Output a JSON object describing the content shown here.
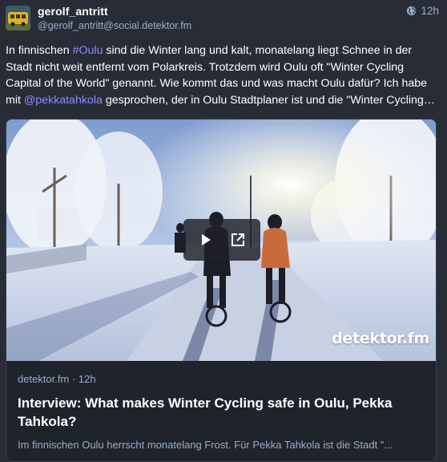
{
  "account": {
    "display_name": "gerolf_antritt",
    "handle": "@gerolf_antritt@social.detektor.fm",
    "avatar": "avatar-yellow-bus"
  },
  "post": {
    "visibility_icon": "globe-icon",
    "time": "12h",
    "lines": [
      {
        "before": "In finnischen ",
        "link": "#Oulu",
        "after": " sind die Winter lang und kalt, monatelang liegt Schnee in der"
      },
      {
        "before": "Stadt nicht weit entfernt vom Polarkreis. Trotzdem wird Oulu oft \"Winter Cycling",
        "link": "",
        "after": ""
      },
      {
        "before": "Capital of the World\" genannt. Wie kommt das und was macht Oulu dafür? Ich habe",
        "link": "",
        "after": ""
      },
      {
        "before": "mit ",
        "link": "@pekkatahkola",
        "after": " gesprochen, der in Oulu Stadtplaner ist und die \"Winter Cycling…"
      }
    ]
  },
  "card": {
    "image_icon": "winter-cyclists-photo",
    "wordmark": "detektor.fm",
    "source": "detektor.fm",
    "separator": " · ",
    "time": "12h",
    "title": "Interview: What makes Winter Cycling safe in Oulu, Pekka Tahkola?",
    "description": "Im finnischen Oulu herrscht monatelang Frost. Für Pekka Tahkola ist die Stadt \"..."
  },
  "colors": {
    "background": "#282c37",
    "link": "#8c8dff",
    "muted": "#9baec8"
  }
}
